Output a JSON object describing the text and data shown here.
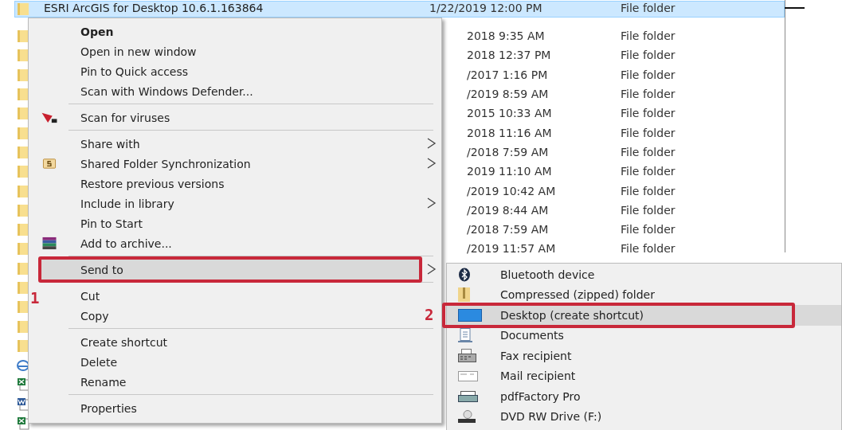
{
  "file_list": {
    "rows": [
      {
        "kind": "folder",
        "name": "ESRI ArcGIS for Desktop 10.6.1.163864",
        "date": "1/22/2019 12:00 PM",
        "type": "File folder",
        "selected": true
      },
      {
        "kind": "folder",
        "date": "2018 9:35 AM",
        "type": "File folder",
        "selected": false
      },
      {
        "kind": "folder",
        "date": "2018 12:37 PM",
        "type": "File folder",
        "selected": false
      },
      {
        "kind": "folder",
        "date": "/2017 1:16 PM",
        "type": "File folder",
        "selected": false
      },
      {
        "kind": "folder",
        "date": "/2019 8:59 AM",
        "type": "File folder",
        "selected": false
      },
      {
        "kind": "folder",
        "date": "2015 10:33 AM",
        "type": "File folder",
        "selected": false
      },
      {
        "kind": "folder",
        "date": "2018 11:16 AM",
        "type": "File folder",
        "selected": false
      },
      {
        "kind": "folder",
        "date": "/2018 7:59 AM",
        "type": "File folder",
        "selected": false
      },
      {
        "kind": "folder",
        "date": "2019 11:10 AM",
        "type": "File folder",
        "selected": false
      },
      {
        "kind": "folder",
        "date": "/2019 10:42 AM",
        "type": "File folder",
        "selected": false
      },
      {
        "kind": "folder",
        "date": "/2019 8:44 AM",
        "type": "File folder",
        "selected": false
      },
      {
        "kind": "folder",
        "date": "/2018 7:59 AM",
        "type": "File folder",
        "selected": false
      },
      {
        "kind": "folder",
        "date": "/2019 11:57 AM",
        "type": "File folder",
        "selected": false
      },
      {
        "kind": "folder",
        "selected": false
      },
      {
        "kind": "folder",
        "selected": false
      },
      {
        "kind": "folder",
        "selected": false
      },
      {
        "kind": "folder",
        "selected": false
      },
      {
        "kind": "folder",
        "selected": false
      },
      {
        "kind": "browser",
        "selected": false
      },
      {
        "kind": "spreadsheet",
        "selected": false
      },
      {
        "kind": "word",
        "selected": false
      },
      {
        "kind": "spreadsheet",
        "selected": false
      }
    ]
  },
  "context_menu": {
    "items": [
      {
        "kind": "item",
        "label": "Open",
        "bold": true,
        "selected": false
      },
      {
        "kind": "item",
        "label": "Open in new window",
        "bold": false,
        "selected": false
      },
      {
        "kind": "item",
        "label": "Pin to Quick access",
        "bold": false,
        "selected": false
      },
      {
        "kind": "item",
        "label": "Scan with Windows Defender...",
        "bold": false,
        "selected": false
      },
      {
        "kind": "separator"
      },
      {
        "kind": "item",
        "label": "Scan for viruses",
        "bold": false,
        "selected": false
      },
      {
        "kind": "separator"
      },
      {
        "kind": "item",
        "label": "Share with",
        "submenu": true,
        "bold": false,
        "selected": false
      },
      {
        "kind": "item",
        "label": "Shared Folder Synchronization",
        "submenu": true,
        "bold": false,
        "selected": false
      },
      {
        "kind": "item",
        "label": "Restore previous versions",
        "bold": false,
        "selected": false
      },
      {
        "kind": "item",
        "label": "Include in library",
        "submenu": true,
        "bold": false,
        "selected": false
      },
      {
        "kind": "item",
        "label": "Pin to Start",
        "bold": false,
        "selected": false
      },
      {
        "kind": "item",
        "label": "Add to archive...",
        "bold": false,
        "selected": false
      },
      {
        "kind": "separator"
      },
      {
        "kind": "item",
        "label": "Send to",
        "submenu": true,
        "bold": false,
        "selected": true,
        "annotation": "1"
      },
      {
        "kind": "separator"
      },
      {
        "kind": "item",
        "label": "Cut",
        "bold": false,
        "selected": false
      },
      {
        "kind": "item",
        "label": "Copy",
        "bold": false,
        "selected": false
      },
      {
        "kind": "separator"
      },
      {
        "kind": "item",
        "label": "Create shortcut",
        "bold": false,
        "selected": false
      },
      {
        "kind": "item",
        "label": "Delete",
        "bold": false,
        "selected": false
      },
      {
        "kind": "item",
        "label": "Rename",
        "bold": false,
        "selected": false
      },
      {
        "kind": "separator"
      },
      {
        "kind": "item",
        "label": "Properties",
        "bold": false,
        "selected": false
      }
    ]
  },
  "send_to_menu": {
    "items": [
      {
        "label": "Bluetooth device",
        "selected": false
      },
      {
        "label": "Compressed (zipped) folder",
        "selected": false
      },
      {
        "label": "Desktop (create shortcut)",
        "selected": true,
        "annotation": "2"
      },
      {
        "label": "Documents",
        "selected": false
      },
      {
        "label": "Fax recipient",
        "selected": false
      },
      {
        "label": "Mail recipient",
        "selected": false
      },
      {
        "label": "pdfFactory Pro",
        "selected": false
      },
      {
        "label": "DVD RW Drive (F:)",
        "selected": false
      }
    ]
  }
}
